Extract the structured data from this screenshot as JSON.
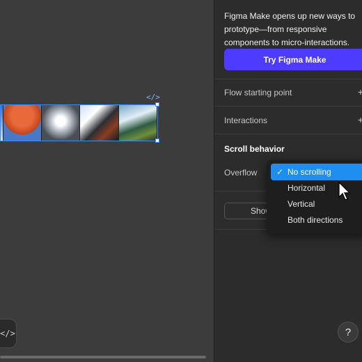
{
  "canvas": {
    "code_badge": "</>",
    "dev_button_icon": "</>"
  },
  "panel": {
    "promo_text": "Figma Make opens up new ways to prototype—from responsive components to micro-interactions.",
    "try_button": "Try Figma Make",
    "flow_starting_point": "Flow starting point",
    "interactions": "Interactions",
    "plus_glyph": "+",
    "scroll_behavior_title": "Scroll behavior",
    "overflow_label": "Overflow",
    "show_button": "Show",
    "help_glyph": "?"
  },
  "dropdown": {
    "check_glyph": "✓",
    "options": [
      {
        "label": "No scrolling",
        "selected": true
      },
      {
        "label": "Horizontal",
        "selected": false
      },
      {
        "label": "Vertical",
        "selected": false
      },
      {
        "label": "Both directions",
        "selected": false
      }
    ]
  },
  "colors": {
    "accent": "#4d3bff",
    "selection": "#1f8ef1",
    "frame_outline": "#3b8bff"
  }
}
